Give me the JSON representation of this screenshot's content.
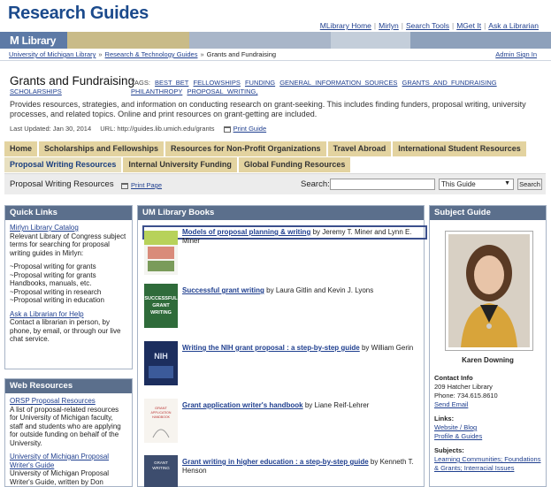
{
  "header": {
    "site_title": "Research Guides",
    "links": [
      "MLibrary Home",
      "Mirlyn",
      "Search Tools",
      "MGet It",
      "Ask a Librarian"
    ],
    "logo_text": "Library",
    "logo_m": "M"
  },
  "breadcrumbs": [
    "University of Michigan Library",
    "Research & Technology Guides",
    "Grants and Fundraising"
  ],
  "admin_link": "Admin Sign In",
  "guide": {
    "title": "Grants and Fundraising",
    "tags_label": "TAGS:",
    "tags": [
      "BEST_BET",
      "FELLOWSHIPS",
      "FUNDING",
      "GENERAL_INFORMATION_SOURCES",
      "GRANTS_AND_FUNDRAISING",
      "PHILANTHROPY",
      "PROPOSAL_WRITING,"
    ],
    "tag_tail": "SCHOLARSHIPS",
    "description": "Provides resources, strategies, and information on conducting research on grant-seeking. This includes finding funders, proposal writing, university processes, and related topics. Online and print resources on grant-getting are included.",
    "last_updated": "Last Updated: Jan 30, 2014",
    "url": "URL: http://guides.lib.umich.edu/grants",
    "print_guide": "Print Guide"
  },
  "tabs_row1": [
    "Home",
    "Scholarships and Fellowships",
    "Resources for Non-Profit Organizations",
    "Travel Abroad",
    "International Student Resources"
  ],
  "tabs_row2": [
    "Proposal Writing Resources",
    "Internal University Funding",
    "Global Funding Resources"
  ],
  "subbar": {
    "page_name": "Proposal Writing Resources",
    "print_page": "Print Page",
    "search_label": "Search:",
    "search_value": "",
    "scope": "This Guide",
    "search_button": "Search"
  },
  "quick_links": {
    "title": "Quick Links",
    "mirlyn_link": "Mirlyn Library Catalog",
    "mirlyn_text": "Relevant Library of Congress subject terms for searching for proposal writing guides in Mirlyn:",
    "items": [
      "~Proposal writing for grants",
      "~Proposal writing for grants Handbooks, manuals, etc.",
      "~Proposal writing in research",
      "~Proposal writing in education"
    ],
    "ask_link": "Ask a Librarian for Help",
    "ask_text": "Contact a librarian in person, by phone, by email, or through our live chat service."
  },
  "web_resources": {
    "title": "Web Resources",
    "orsp_link": "ORSP Proposal Resources",
    "orsp_text": "A list of proposal-related resources for University of Michigan faculty, staff and students who are applying for outside funding on behalf of the University.",
    "umpw_link": "University of Michigan Proposal Writer's Guide",
    "umpw_text": "University of Michigan Proposal Writer's Guide, written by Don"
  },
  "books": {
    "title": "UM Library Books",
    "items": [
      {
        "title": "Models of proposal planning & writing",
        "by": "by Jeremy T. Miner and Lynn E. Miner"
      },
      {
        "title": "Successful grant writing",
        "by": "by Laura Gitlin and Kevin J. Lyons"
      },
      {
        "title": "Writing the NIH grant proposal : a step-by-step guide",
        "by": "by William Gerin"
      },
      {
        "title": "Grant application writer's handbook",
        "by": "by Liane Reif-Lehrer"
      },
      {
        "title": "Grant writing in higher education : a step-by-step guide",
        "by": "by Kenneth T. Henson"
      }
    ],
    "cover2_text": "SUCCESSFUL GRANT WRITING",
    "cover3_text": "NIH",
    "cover4_text": "GRANT APPLICATION WRITER'S HANDBOOK",
    "cover5_text": "GRANT WRITING"
  },
  "subject_guide": {
    "title": "Subject Guide",
    "name": "Karen Downing",
    "contact_label": "Contact Info",
    "address": "209 Hatcher Library",
    "phone": "Phone: 734.615.8610",
    "send_email": "Send Email",
    "links_label": "Links:",
    "links": [
      "Website / Blog",
      "Profile & Guides"
    ],
    "subjects_label": "Subjects:",
    "subjects": "Learning Communities; Foundations & Grants; Interracial Issues"
  },
  "colors": {
    "brand_blue": "#1b4a8c",
    "panel_header": "#5b6f8c",
    "tab_tan": "#e3d3a0"
  }
}
